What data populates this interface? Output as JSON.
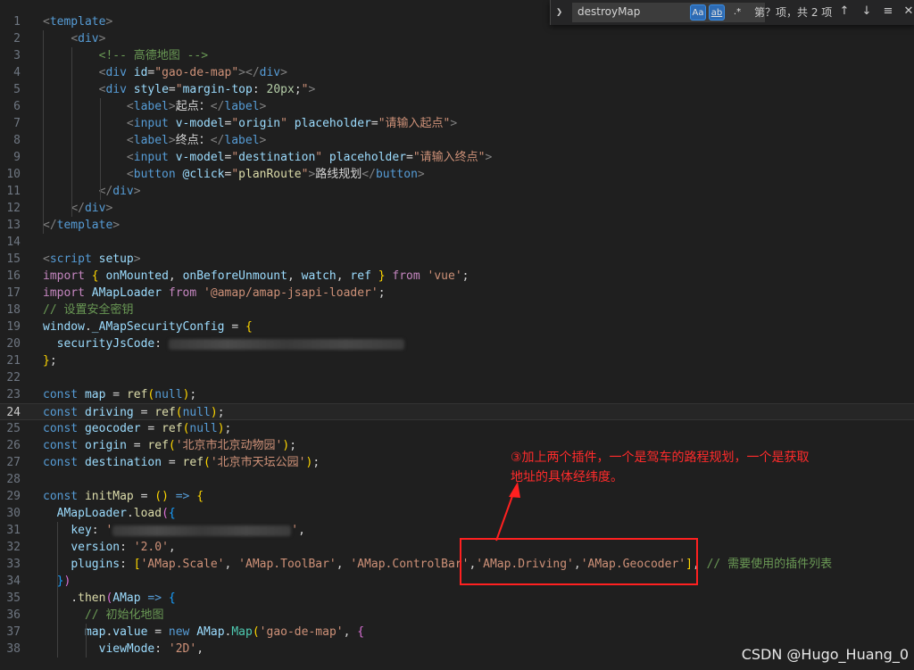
{
  "find": {
    "query": "destroyMap",
    "match_case": "Aa",
    "whole_word": "ab",
    "regex": ".*",
    "result": "第？项，共 2 项"
  },
  "annotation": {
    "line1": "③加上两个插件，一个是驾车的路程规划，一个是获取",
    "line2": "地址的具体经纬度。"
  },
  "watermark": "CSDN @Hugo_Huang_0",
  "colors": {
    "accent": "#ff2020",
    "bg": "#1f1f1f"
  },
  "lines": [
    {
      "n": "1",
      "toks": [
        [
          "t-br",
          "<"
        ],
        [
          "t-tag",
          "template"
        ],
        [
          "t-br",
          ">"
        ]
      ]
    },
    {
      "n": "2",
      "toks": [
        [
          "t-plain",
          "    "
        ],
        [
          "t-br",
          "<"
        ],
        [
          "t-tag",
          "div"
        ],
        [
          "t-br",
          ">"
        ]
      ]
    },
    {
      "n": "3",
      "toks": [
        [
          "t-plain",
          "        "
        ],
        [
          "t-cm",
          "<!-- 高德地图 -->"
        ]
      ]
    },
    {
      "n": "4",
      "toks": [
        [
          "t-plain",
          "        "
        ],
        [
          "t-br",
          "<"
        ],
        [
          "t-tag",
          "div"
        ],
        [
          "t-plain",
          " "
        ],
        [
          "t-attr",
          "id"
        ],
        [
          "t-plain",
          "="
        ],
        [
          "t-str",
          "\"gao-de-map\""
        ],
        [
          "t-br",
          "></"
        ],
        [
          "t-tag",
          "div"
        ],
        [
          "t-br",
          ">"
        ]
      ]
    },
    {
      "n": "5",
      "toks": [
        [
          "t-plain",
          "        "
        ],
        [
          "t-br",
          "<"
        ],
        [
          "t-tag",
          "div"
        ],
        [
          "t-plain",
          " "
        ],
        [
          "t-attr",
          "style"
        ],
        [
          "t-plain",
          "="
        ],
        [
          "t-str",
          "\""
        ],
        [
          "t-var",
          "margin-top"
        ],
        [
          "t-plain",
          ": "
        ],
        [
          "t-num",
          "20px"
        ],
        [
          "t-plain",
          ";"
        ],
        [
          "t-str",
          "\""
        ],
        [
          "t-br",
          ">"
        ]
      ]
    },
    {
      "n": "6",
      "toks": [
        [
          "t-plain",
          "            "
        ],
        [
          "t-br",
          "<"
        ],
        [
          "t-tag",
          "label"
        ],
        [
          "t-br",
          ">"
        ],
        [
          "t-txt",
          "起点："
        ],
        [
          "t-br",
          "</"
        ],
        [
          "t-tag",
          "label"
        ],
        [
          "t-br",
          ">"
        ]
      ]
    },
    {
      "n": "7",
      "toks": [
        [
          "t-plain",
          "            "
        ],
        [
          "t-br",
          "<"
        ],
        [
          "t-tag",
          "input"
        ],
        [
          "t-plain",
          " "
        ],
        [
          "t-attr",
          "v-model"
        ],
        [
          "t-plain",
          "="
        ],
        [
          "t-str",
          "\""
        ],
        [
          "t-var",
          "origin"
        ],
        [
          "t-str",
          "\""
        ],
        [
          "t-plain",
          " "
        ],
        [
          "t-attr",
          "placeholder"
        ],
        [
          "t-plain",
          "="
        ],
        [
          "t-str",
          "\"请输入起点\""
        ],
        [
          "t-br",
          ">"
        ]
      ]
    },
    {
      "n": "8",
      "toks": [
        [
          "t-plain",
          "            "
        ],
        [
          "t-br",
          "<"
        ],
        [
          "t-tag",
          "label"
        ],
        [
          "t-br",
          ">"
        ],
        [
          "t-txt",
          "终点："
        ],
        [
          "t-br",
          "</"
        ],
        [
          "t-tag",
          "label"
        ],
        [
          "t-br",
          ">"
        ]
      ]
    },
    {
      "n": "9",
      "toks": [
        [
          "t-plain",
          "            "
        ],
        [
          "t-br",
          "<"
        ],
        [
          "t-tag",
          "input"
        ],
        [
          "t-plain",
          " "
        ],
        [
          "t-attr",
          "v-model"
        ],
        [
          "t-plain",
          "="
        ],
        [
          "t-str",
          "\""
        ],
        [
          "t-var",
          "destination"
        ],
        [
          "t-str",
          "\""
        ],
        [
          "t-plain",
          " "
        ],
        [
          "t-attr",
          "placeholder"
        ],
        [
          "t-plain",
          "="
        ],
        [
          "t-str",
          "\"请输入终点\""
        ],
        [
          "t-br",
          ">"
        ]
      ]
    },
    {
      "n": "10",
      "toks": [
        [
          "t-plain",
          "            "
        ],
        [
          "t-br",
          "<"
        ],
        [
          "t-tag",
          "button"
        ],
        [
          "t-plain",
          " "
        ],
        [
          "t-attr",
          "@click"
        ],
        [
          "t-plain",
          "="
        ],
        [
          "t-str",
          "\""
        ],
        [
          "t-fn",
          "planRoute"
        ],
        [
          "t-str",
          "\""
        ],
        [
          "t-br",
          ">"
        ],
        [
          "t-txt",
          "路线规划"
        ],
        [
          "t-br",
          "</"
        ],
        [
          "t-tag",
          "button"
        ],
        [
          "t-br",
          ">"
        ]
      ]
    },
    {
      "n": "11",
      "toks": [
        [
          "t-plain",
          "        "
        ],
        [
          "t-br",
          "</"
        ],
        [
          "t-tag",
          "div"
        ],
        [
          "t-br",
          ">"
        ]
      ]
    },
    {
      "n": "12",
      "toks": [
        [
          "t-plain",
          "    "
        ],
        [
          "t-br",
          "</"
        ],
        [
          "t-tag",
          "div"
        ],
        [
          "t-br",
          ">"
        ]
      ]
    },
    {
      "n": "13",
      "toks": [
        [
          "t-br",
          "</"
        ],
        [
          "t-tag",
          "template"
        ],
        [
          "t-br",
          ">"
        ]
      ]
    },
    {
      "n": "14",
      "toks": []
    },
    {
      "n": "15",
      "toks": [
        [
          "t-br",
          "<"
        ],
        [
          "t-tag",
          "script"
        ],
        [
          "t-plain",
          " "
        ],
        [
          "t-attr",
          "setup"
        ],
        [
          "t-br",
          ">"
        ]
      ]
    },
    {
      "n": "16",
      "toks": [
        [
          "t-kw2",
          "import"
        ],
        [
          "t-plain",
          " "
        ],
        [
          "t-brk",
          "{"
        ],
        [
          "t-plain",
          " "
        ],
        [
          "t-var",
          "onMounted"
        ],
        [
          "t-plain",
          ", "
        ],
        [
          "t-var",
          "onBeforeUnmount"
        ],
        [
          "t-plain",
          ", "
        ],
        [
          "t-var",
          "watch"
        ],
        [
          "t-plain",
          ", "
        ],
        [
          "t-var",
          "ref"
        ],
        [
          "t-plain",
          " "
        ],
        [
          "t-brk",
          "}"
        ],
        [
          "t-plain",
          " "
        ],
        [
          "t-kw2",
          "from"
        ],
        [
          "t-plain",
          " "
        ],
        [
          "t-str",
          "'vue'"
        ],
        [
          "t-plain",
          ";"
        ]
      ]
    },
    {
      "n": "17",
      "toks": [
        [
          "t-kw2",
          "import"
        ],
        [
          "t-plain",
          " "
        ],
        [
          "t-var",
          "AMapLoader"
        ],
        [
          "t-plain",
          " "
        ],
        [
          "t-kw2",
          "from"
        ],
        [
          "t-plain",
          " "
        ],
        [
          "t-str",
          "'@amap/amap-jsapi-loader'"
        ],
        [
          "t-plain",
          ";"
        ]
      ]
    },
    {
      "n": "18",
      "toks": [
        [
          "t-cm",
          "// 设置安全密钥"
        ]
      ]
    },
    {
      "n": "19",
      "toks": [
        [
          "t-var",
          "window"
        ],
        [
          "t-plain",
          "."
        ],
        [
          "t-var",
          "_AMapSecurityConfig"
        ],
        [
          "t-plain",
          " = "
        ],
        [
          "t-brk",
          "{"
        ]
      ]
    },
    {
      "n": "20",
      "toks": [
        [
          "t-plain",
          "  "
        ],
        [
          "t-var",
          "securityJsCode"
        ],
        [
          "t-plain",
          ": "
        ],
        [
          "blur",
          "264"
        ]
      ]
    },
    {
      "n": "21",
      "toks": [
        [
          "t-brk",
          "}"
        ],
        [
          "t-plain",
          ";"
        ]
      ]
    },
    {
      "n": "22",
      "toks": []
    },
    {
      "n": "23",
      "toks": [
        [
          "t-kw",
          "const"
        ],
        [
          "t-plain",
          " "
        ],
        [
          "t-var",
          "map"
        ],
        [
          "t-plain",
          " = "
        ],
        [
          "t-fn",
          "ref"
        ],
        [
          "t-brk",
          "("
        ],
        [
          "t-kw",
          "null"
        ],
        [
          "t-brk",
          ")"
        ],
        [
          "t-plain",
          ";"
        ]
      ]
    },
    {
      "n": "24",
      "cur": true,
      "toks": [
        [
          "t-kw",
          "const"
        ],
        [
          "t-plain",
          " "
        ],
        [
          "t-var",
          "driving"
        ],
        [
          "t-plain",
          " = "
        ],
        [
          "t-fn",
          "ref"
        ],
        [
          "t-brk",
          "("
        ],
        [
          "t-kw",
          "null"
        ],
        [
          "t-brk",
          ")"
        ],
        [
          "t-plain",
          ";"
        ]
      ]
    },
    {
      "n": "25",
      "toks": [
        [
          "t-kw",
          "const"
        ],
        [
          "t-plain",
          " "
        ],
        [
          "t-var",
          "geocoder"
        ],
        [
          "t-plain",
          " = "
        ],
        [
          "t-fn",
          "ref"
        ],
        [
          "t-brk",
          "("
        ],
        [
          "t-kw",
          "null"
        ],
        [
          "t-brk",
          ")"
        ],
        [
          "t-plain",
          ";"
        ]
      ]
    },
    {
      "n": "26",
      "toks": [
        [
          "t-kw",
          "const"
        ],
        [
          "t-plain",
          " "
        ],
        [
          "t-var",
          "origin"
        ],
        [
          "t-plain",
          " = "
        ],
        [
          "t-fn",
          "ref"
        ],
        [
          "t-brk",
          "("
        ],
        [
          "t-str",
          "'北京市北京动物园'"
        ],
        [
          "t-brk",
          ")"
        ],
        [
          "t-plain",
          ";"
        ]
      ]
    },
    {
      "n": "27",
      "toks": [
        [
          "t-kw",
          "const"
        ],
        [
          "t-plain",
          " "
        ],
        [
          "t-var",
          "destination"
        ],
        [
          "t-plain",
          " = "
        ],
        [
          "t-fn",
          "ref"
        ],
        [
          "t-brk",
          "("
        ],
        [
          "t-str",
          "'北京市天坛公园'"
        ],
        [
          "t-brk",
          ")"
        ],
        [
          "t-plain",
          ";"
        ]
      ]
    },
    {
      "n": "28",
      "toks": []
    },
    {
      "n": "29",
      "toks": [
        [
          "t-kw",
          "const"
        ],
        [
          "t-plain",
          " "
        ],
        [
          "t-fn",
          "initMap"
        ],
        [
          "t-plain",
          " = "
        ],
        [
          "t-brk",
          "("
        ],
        [
          "t-brk",
          ")"
        ],
        [
          "t-plain",
          " "
        ],
        [
          "t-kw",
          "=>"
        ],
        [
          "t-plain",
          " "
        ],
        [
          "t-brk",
          "{"
        ]
      ]
    },
    {
      "n": "30",
      "toks": [
        [
          "t-plain",
          "  "
        ],
        [
          "t-var",
          "AMapLoader"
        ],
        [
          "t-plain",
          "."
        ],
        [
          "t-fn",
          "load"
        ],
        [
          "t-brk2",
          "("
        ],
        [
          "t-brk3",
          "{"
        ]
      ]
    },
    {
      "n": "31",
      "toks": [
        [
          "t-plain",
          "    "
        ],
        [
          "t-var",
          "key"
        ],
        [
          "t-plain",
          ": "
        ],
        [
          "t-str",
          "'"
        ],
        [
          "blur",
          "200"
        ],
        [
          "t-str",
          "'"
        ],
        [
          "t-plain",
          ","
        ]
      ]
    },
    {
      "n": "32",
      "toks": [
        [
          "t-plain",
          "    "
        ],
        [
          "t-var",
          "version"
        ],
        [
          "t-plain",
          ": "
        ],
        [
          "t-str",
          "'2.0'"
        ],
        [
          "t-plain",
          ","
        ]
      ]
    },
    {
      "n": "33",
      "toks": [
        [
          "t-plain",
          "    "
        ],
        [
          "t-var",
          "plugins"
        ],
        [
          "t-plain",
          ": "
        ],
        [
          "t-brk",
          "["
        ],
        [
          "t-str",
          "'AMap.Scale'"
        ],
        [
          "t-plain",
          ", "
        ],
        [
          "t-str",
          "'AMap.ToolBar'"
        ],
        [
          "t-plain",
          ", "
        ],
        [
          "t-str",
          "'AMap.ControlBar'"
        ],
        [
          "t-plain",
          ","
        ],
        [
          "t-str",
          "'AMap.Driving'"
        ],
        [
          "t-plain",
          ","
        ],
        [
          "t-str",
          "'AMap.Geocoder'"
        ],
        [
          "t-brk",
          "]"
        ],
        [
          "t-plain",
          ", "
        ],
        [
          "t-cm",
          "// 需要使用的插件列表"
        ]
      ]
    },
    {
      "n": "34",
      "toks": [
        [
          "t-plain",
          "  "
        ],
        [
          "t-brk3",
          "}"
        ],
        [
          "t-brk2",
          ")"
        ]
      ]
    },
    {
      "n": "35",
      "toks": [
        [
          "t-plain",
          "    ."
        ],
        [
          "t-fn",
          "then"
        ],
        [
          "t-brk2",
          "("
        ],
        [
          "t-var",
          "AMap"
        ],
        [
          "t-plain",
          " "
        ],
        [
          "t-kw",
          "=>"
        ],
        [
          "t-plain",
          " "
        ],
        [
          "t-brk3",
          "{"
        ]
      ]
    },
    {
      "n": "36",
      "toks": [
        [
          "t-plain",
          "      "
        ],
        [
          "t-cm",
          "// 初始化地图"
        ]
      ]
    },
    {
      "n": "37",
      "toks": [
        [
          "t-plain",
          "      "
        ],
        [
          "t-var",
          "map"
        ],
        [
          "t-plain",
          "."
        ],
        [
          "t-var",
          "value"
        ],
        [
          "t-plain",
          " = "
        ],
        [
          "t-kw",
          "new"
        ],
        [
          "t-plain",
          " "
        ],
        [
          "t-var",
          "AMap"
        ],
        [
          "t-plain",
          "."
        ],
        [
          "t-cls",
          "Map"
        ],
        [
          "t-brk",
          "("
        ],
        [
          "t-str",
          "'gao-de-map'"
        ],
        [
          "t-plain",
          ", "
        ],
        [
          "t-brk2",
          "{"
        ]
      ]
    },
    {
      "n": "38",
      "toks": [
        [
          "t-plain",
          "        "
        ],
        [
          "t-var",
          "viewMode"
        ],
        [
          "t-plain",
          ": "
        ],
        [
          "t-str",
          "'2D'"
        ],
        [
          "t-plain",
          ","
        ]
      ]
    }
  ]
}
